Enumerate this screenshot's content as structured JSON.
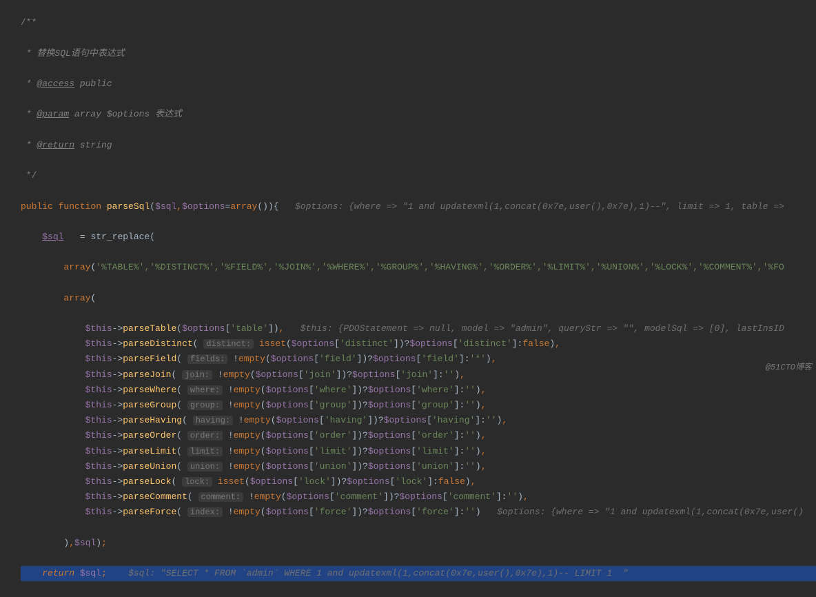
{
  "doc": {
    "open": "/**",
    "line1": " * 替换SQL语句中表达式",
    "line2_pre": " * ",
    "tag_access": "@access",
    "access_val": " public",
    "line3_pre": " * ",
    "tag_param": "@param",
    "param_type": " array $options",
    "param_desc": " 表达式",
    "line4_pre": " * ",
    "tag_return": "@return",
    "return_val": " string",
    "close": " */"
  },
  "sig": {
    "kw_public": "public",
    "kw_function": "function",
    "name": " parseSql",
    "p_sql": "$sql",
    "p_options": "$options",
    "kw_array": "array",
    "hint": "$options: {where => \"1 and updatexml(1,concat(0x7e,user(),0x7e),1)--\", limit => 1, table =>"
  },
  "body": {
    "sql_var": "$sql",
    "eq": "   = ",
    "str_replace": "str_replace",
    "arr1": {
      "kw_array": "array",
      "items": "'%TABLE%','%DISTINCT%','%FIELD%','%JOIN%','%WHERE%','%GROUP%','%HAVING%','%ORDER%','%LIMIT%','%UNION%','%LOCK%','%COMMENT%','%FO"
    },
    "arr2": {
      "kw_array": "array",
      "rows": [
        {
          "this": "$this",
          "arrow": "->",
          "fn": "parseTable",
          "pre": "(",
          "hint_inlay": null,
          "body": "$options['table'])",
          "tail": ",   ",
          "hint": "$this: {PDOStatement => null, model => \"admin\", queryStr => \"\", modelSql => [0], lastInsID"
        },
        {
          "this": "$this",
          "arrow": "->",
          "fn": "parseDistinct",
          "pre": "( ",
          "hint_inlay": "distinct:",
          "body": " isset($options['distinct'])?$options['distinct']:false)",
          "tail": ",",
          "hint": null
        },
        {
          "this": "$this",
          "arrow": "->",
          "fn": "parseField",
          "pre": "( ",
          "hint_inlay": "fields:",
          "body": " !empty($options['field'])?$options['field']:'*')",
          "tail": ",",
          "hint": null
        },
        {
          "this": "$this",
          "arrow": "->",
          "fn": "parseJoin",
          "pre": "( ",
          "hint_inlay": "join:",
          "body": " !empty($options['join'])?$options['join']:'')",
          "tail": ",",
          "hint": null
        },
        {
          "this": "$this",
          "arrow": "->",
          "fn": "parseWhere",
          "pre": "( ",
          "hint_inlay": "where:",
          "body": " !empty($options['where'])?$options['where']:'')",
          "tail": ",",
          "hint": null
        },
        {
          "this": "$this",
          "arrow": "->",
          "fn": "parseGroup",
          "pre": "( ",
          "hint_inlay": "group:",
          "body": " !empty($options['group'])?$options['group']:'')",
          "tail": ",",
          "hint": null
        },
        {
          "this": "$this",
          "arrow": "->",
          "fn": "parseHaving",
          "pre": "( ",
          "hint_inlay": "having:",
          "body": " !empty($options['having'])?$options['having']:'')",
          "tail": ",",
          "hint": null
        },
        {
          "this": "$this",
          "arrow": "->",
          "fn": "parseOrder",
          "pre": "( ",
          "hint_inlay": "order:",
          "body": " !empty($options['order'])?$options['order']:'')",
          "tail": ",",
          "hint": null
        },
        {
          "this": "$this",
          "arrow": "->",
          "fn": "parseLimit",
          "pre": "( ",
          "hint_inlay": "limit:",
          "body": " !empty($options['limit'])?$options['limit']:'')",
          "tail": ",",
          "hint": null
        },
        {
          "this": "$this",
          "arrow": "->",
          "fn": "parseUnion",
          "pre": "( ",
          "hint_inlay": "union:",
          "body": " !empty($options['union'])?$options['union']:'')",
          "tail": ",",
          "hint": null
        },
        {
          "this": "$this",
          "arrow": "->",
          "fn": "parseLock",
          "pre": "( ",
          "hint_inlay": "lock:",
          "body": " isset($options['lock'])?$options['lock']:false)",
          "tail": ",",
          "hint": null
        },
        {
          "this": "$this",
          "arrow": "->",
          "fn": "parseComment",
          "pre": "( ",
          "hint_inlay": "comment:",
          "body": " !empty($options['comment'])?$options['comment']:'')",
          "tail": ",",
          "hint": null
        },
        {
          "this": "$this",
          "arrow": "->",
          "fn": "parseForce",
          "pre": "( ",
          "hint_inlay": "index:",
          "body": " !empty($options['force'])?$options['force']:'')",
          "tail": "   ",
          "hint": "$options: {where => \"1 and updatexml(1,concat(0x7e,user()"
        }
      ],
      "close": "),$sql);"
    },
    "ret": {
      "kw_return": "return",
      "var": " $sql",
      "semi": ";",
      "hint": "$sql: \"SELECT * FROM `admin` WHERE 1 and updatexml(1,concat(0x7e,user(),0x7e),1)-- LIMIT 1  \""
    }
  },
  "watermark": "@51CTO博客"
}
